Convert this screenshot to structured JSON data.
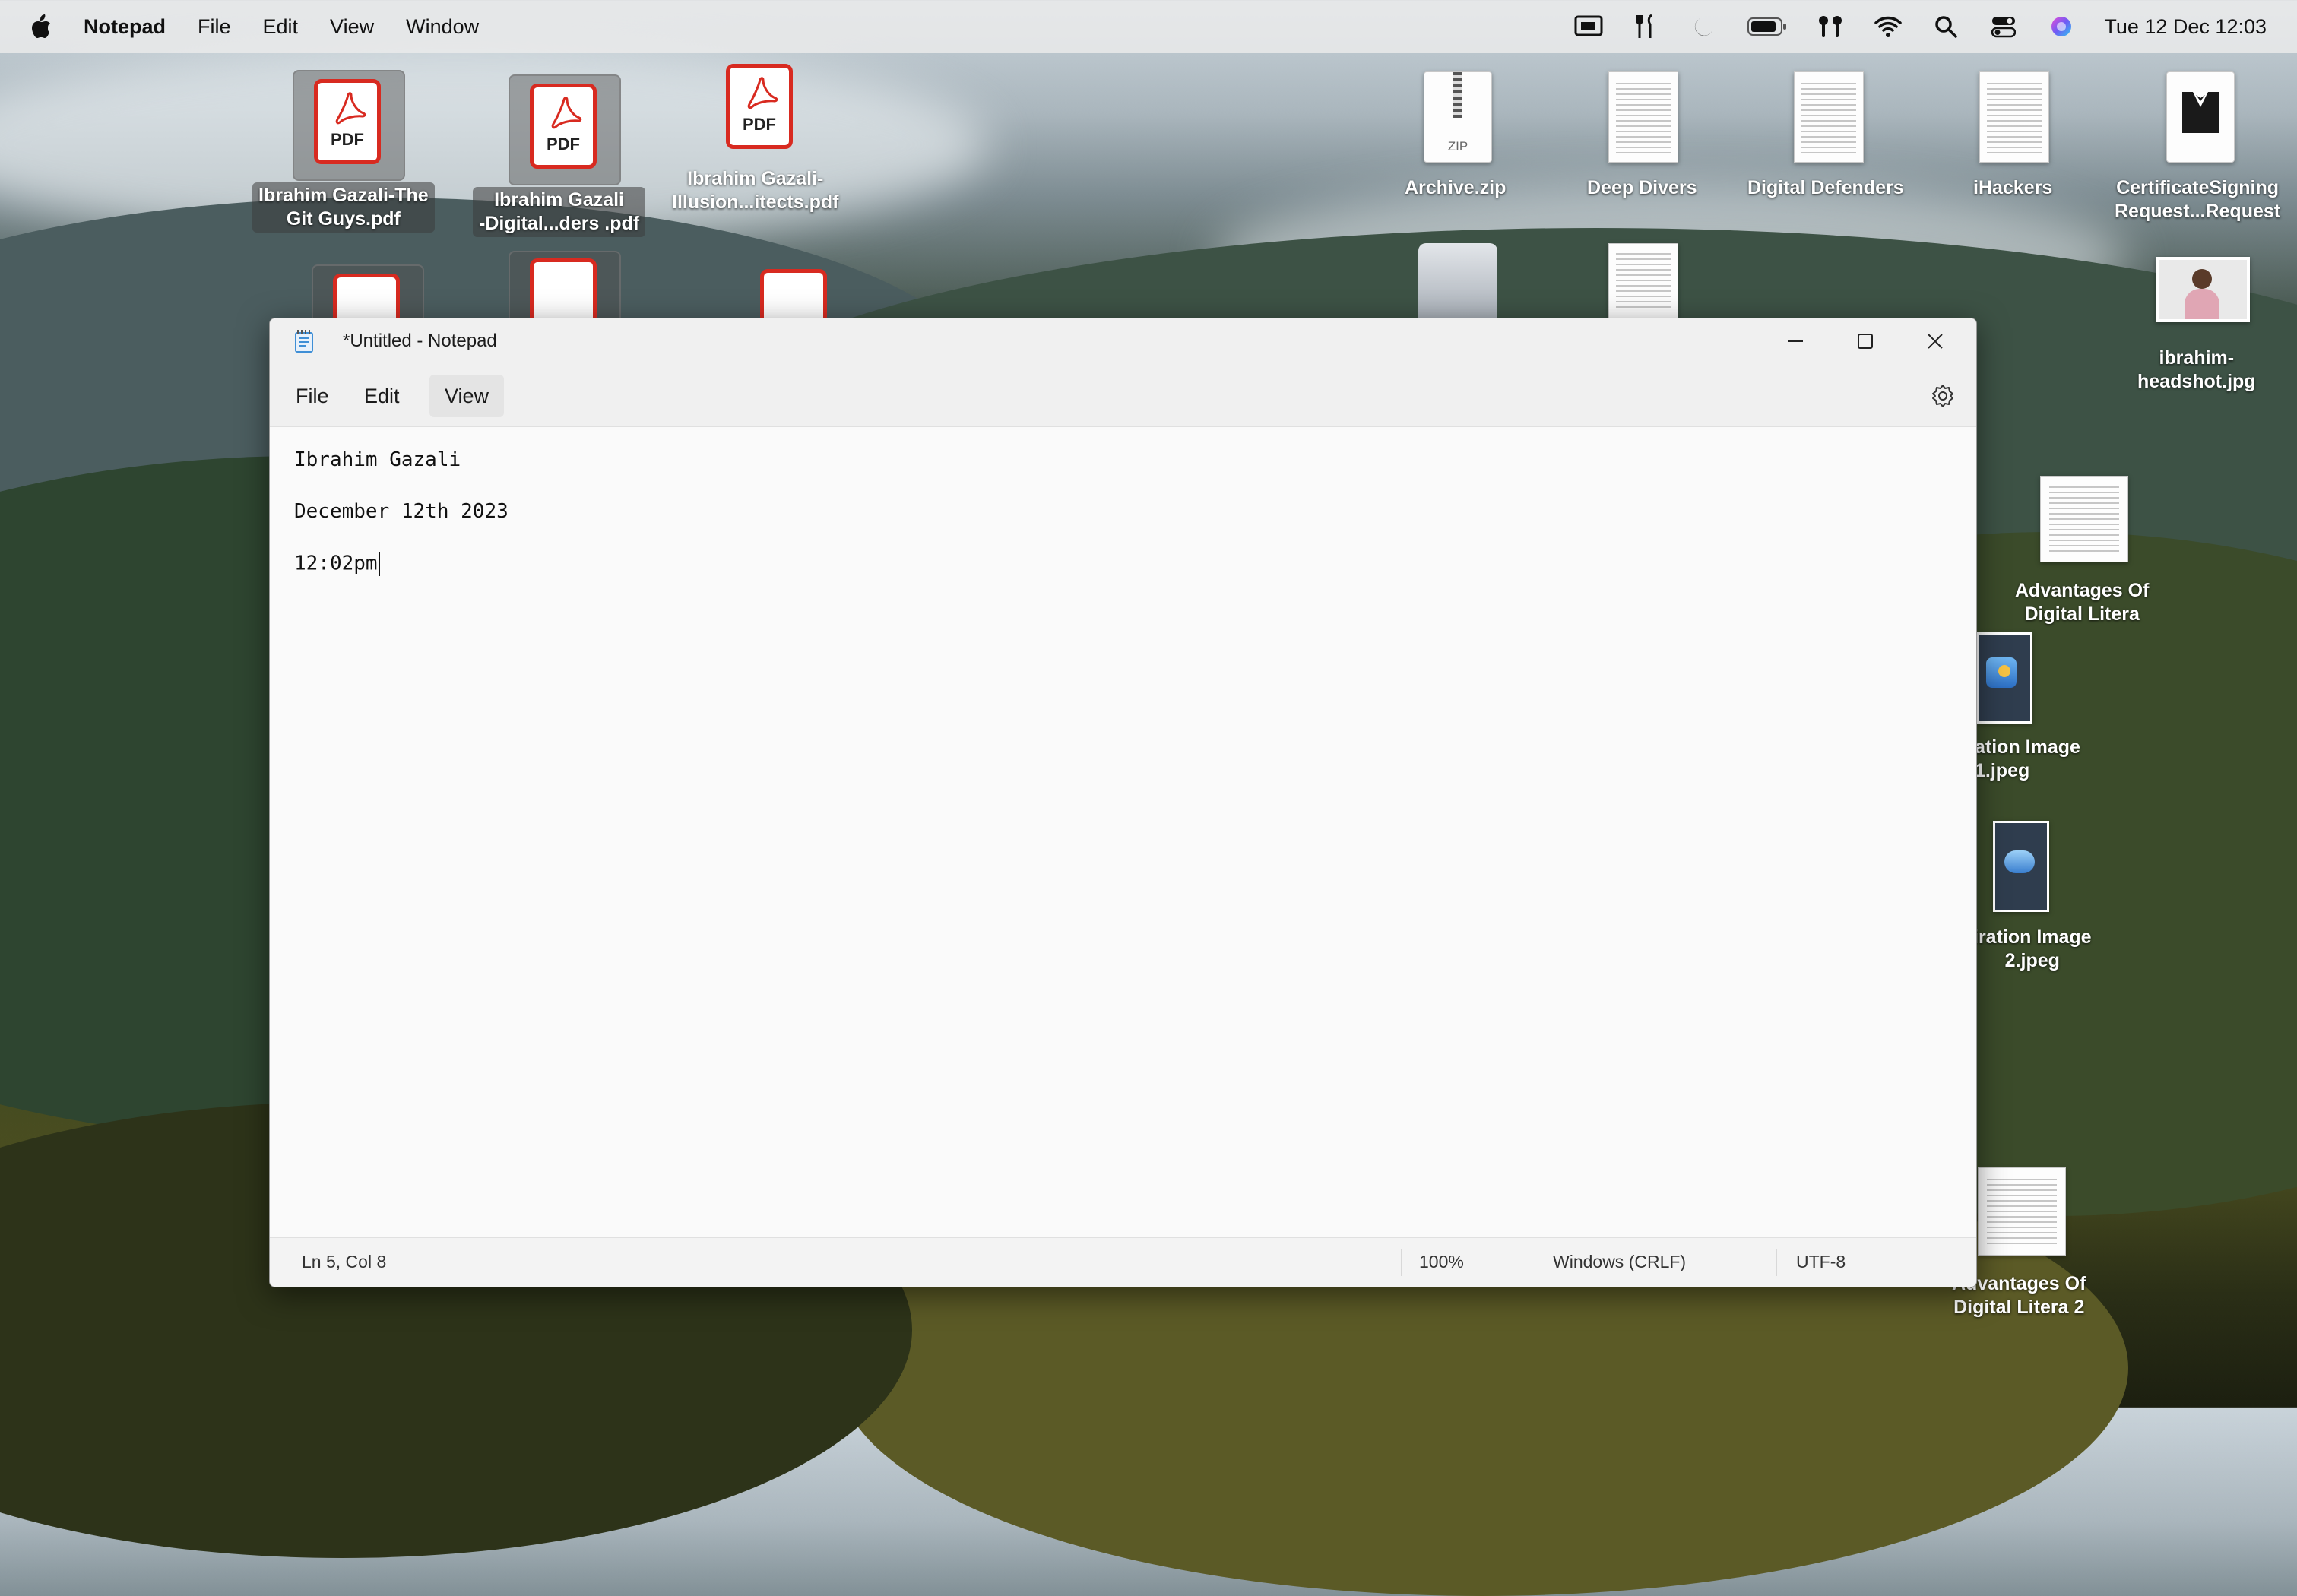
{
  "menubar": {
    "app_name": "Notepad",
    "menus": [
      "File",
      "Edit",
      "View",
      "Window"
    ],
    "status_icons": [
      "screen-mirroring-icon",
      "tools-icon",
      "moon-icon",
      "battery-icon",
      "airpods-icon",
      "wifi-icon",
      "search-icon",
      "control-center-icon",
      "siri-icon"
    ],
    "clock": "Tue 12 Dec  12:03"
  },
  "desktop": {
    "pdf_icon_text": "PDF",
    "zip_icon_text": "ZIP",
    "icons": [
      {
        "label_line1": "Ibrahim Gazali-The",
        "label_line2": "Git Guys.pdf"
      },
      {
        "label_line1": "Ibrahim Gazali",
        "label_line2": "-Digital...ders .pdf"
      },
      {
        "label_line1": "Ibrahim Gazali-",
        "label_line2": "Illusion...itects.pdf"
      },
      {
        "label_line1": "Archive.zip"
      },
      {
        "label_line1": "Deep Divers"
      },
      {
        "label_line1": "Digital Defenders"
      },
      {
        "label_line1": "iHackers"
      },
      {
        "label_line1": "CertificateSigning",
        "label_line2": "Request...Request"
      },
      {
        "label_line1": "ibrahim-",
        "label_line2": "headshot.jpg"
      },
      {
        "label_line1": "Advantages Of",
        "label_line2": "Digital Litera"
      },
      {
        "label_line1": "ation Image",
        "label_line2": "1.jpeg"
      },
      {
        "label_line1": "iration Image",
        "label_line2": "2.jpeg"
      },
      {
        "label_line1": "Advantages Of",
        "label_line2": "Digital Litera 2"
      }
    ]
  },
  "notepad": {
    "title": "*Untitled - Notepad",
    "menus": [
      "File",
      "Edit",
      "View"
    ],
    "lines": [
      "Ibrahim Gazali",
      "December 12th 2023",
      "12:02pm"
    ],
    "status": {
      "position": "Ln 5, Col 8",
      "zoom": "100%",
      "line_ending": "Windows (CRLF)",
      "encoding": "UTF-8"
    }
  },
  "colors": {
    "pdf_red": "#d82a20",
    "menubar_bg": "#ececec",
    "window_bg": "#fafafa"
  }
}
